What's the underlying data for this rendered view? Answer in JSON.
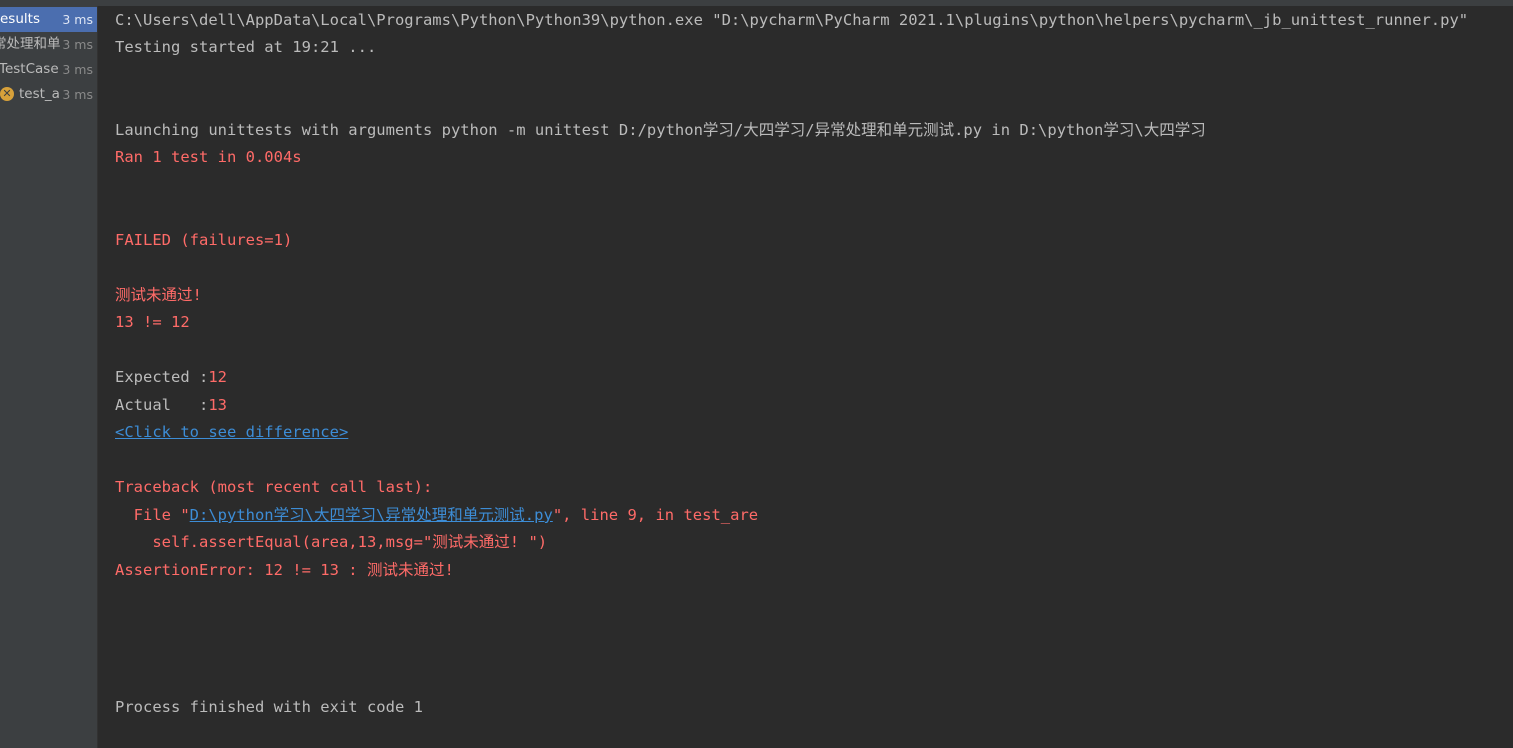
{
  "sidebar": {
    "items": [
      {
        "label": "esults",
        "time": "3 ms"
      },
      {
        "label": "常处理和单",
        "time": "3 ms"
      },
      {
        "label": "TestCase",
        "time": "3 ms"
      },
      {
        "label": "test_a",
        "time": "3 ms",
        "status_icon": "fail-icon",
        "icon_glyph": "✕"
      }
    ]
  },
  "console": {
    "command_line": "C:\\Users\\dell\\AppData\\Local\\Programs\\Python\\Python39\\python.exe \"D:\\pycharm\\PyCharm 2021.1\\plugins\\python\\helpers\\pycharm\\_jb_unittest_runner.py\"",
    "testing_started": "Testing started at 19:21 ...",
    "launching": "Launching unittests with arguments python -m unittest D:/python学习/大四学习/异常处理和单元测试.py in D:\\python学习\\大四学习",
    "ran": "Ran 1 test in 0.004s",
    "failed": "FAILED (failures=1)",
    "message": "测试未通过!",
    "comparison": "13 != 12",
    "expected_label": "Expected :",
    "expected_value": "12",
    "actual_label": "Actual   :",
    "actual_value": "13",
    "diff_link": "<Click to see difference>",
    "traceback_header": "Traceback (most recent call last):",
    "file_prefix": "  File \"",
    "file_path": "D:\\python学习\\大四学习\\异常处理和单元测试.py",
    "file_suffix": "\", line 9, in test_are",
    "code_line": "    self.assertEqual(area,13,msg=\"测试未通过! \")",
    "assertion_error": "AssertionError: 12 != 13 : 测试未通过!",
    "process_finished": "Process finished with exit code 1"
  },
  "colors": {
    "background": "#2b2b2b",
    "sidebar": "#3c3f41",
    "selected": "#4b6eaf",
    "text": "#bbbbbb",
    "error": "#ff6b68",
    "link": "#3d8dd6",
    "fail_icon": "#d7a13a"
  }
}
